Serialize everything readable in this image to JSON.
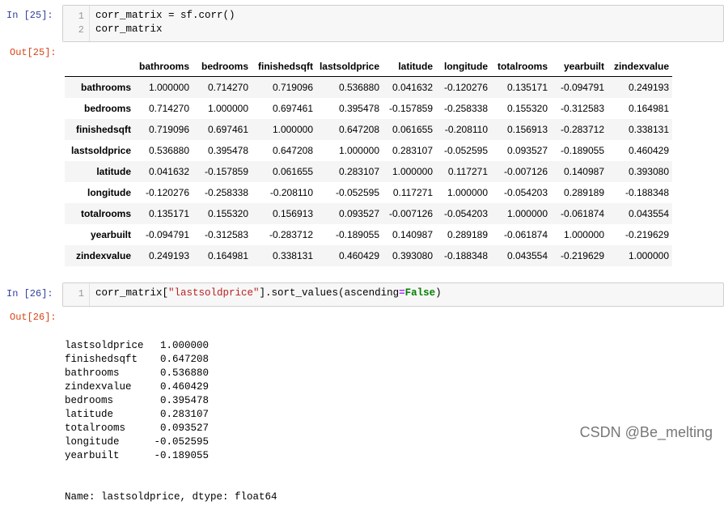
{
  "cell1": {
    "in_prompt": "In  [25]:",
    "line_numbers": [
      "1",
      "2"
    ],
    "code_line1": "corr_matrix = sf.corr()",
    "code_line2": "corr_matrix",
    "out_prompt": "Out[25]:"
  },
  "table": {
    "columns": [
      "bathrooms",
      "bedrooms",
      "finishedsqft",
      "lastsoldprice",
      "latitude",
      "longitude",
      "totalrooms",
      "yearbuilt",
      "zindexvalue"
    ],
    "rows": [
      {
        "label": "bathrooms",
        "values": [
          "1.000000",
          "0.714270",
          "0.719096",
          "0.536880",
          "0.041632",
          "-0.120276",
          "0.135171",
          "-0.094791",
          "0.249193"
        ]
      },
      {
        "label": "bedrooms",
        "values": [
          "0.714270",
          "1.000000",
          "0.697461",
          "0.395478",
          "-0.157859",
          "-0.258338",
          "0.155320",
          "-0.312583",
          "0.164981"
        ]
      },
      {
        "label": "finishedsqft",
        "values": [
          "0.719096",
          "0.697461",
          "1.000000",
          "0.647208",
          "0.061655",
          "-0.208110",
          "0.156913",
          "-0.283712",
          "0.338131"
        ]
      },
      {
        "label": "lastsoldprice",
        "values": [
          "0.536880",
          "0.395478",
          "0.647208",
          "1.000000",
          "0.283107",
          "-0.052595",
          "0.093527",
          "-0.189055",
          "0.460429"
        ]
      },
      {
        "label": "latitude",
        "values": [
          "0.041632",
          "-0.157859",
          "0.061655",
          "0.283107",
          "1.000000",
          "0.117271",
          "-0.007126",
          "0.140987",
          "0.393080"
        ]
      },
      {
        "label": "longitude",
        "values": [
          "-0.120276",
          "-0.258338",
          "-0.208110",
          "-0.052595",
          "0.117271",
          "1.000000",
          "-0.054203",
          "0.289189",
          "-0.188348"
        ]
      },
      {
        "label": "totalrooms",
        "values": [
          "0.135171",
          "0.155320",
          "0.156913",
          "0.093527",
          "-0.007126",
          "-0.054203",
          "1.000000",
          "-0.061874",
          "0.043554"
        ]
      },
      {
        "label": "yearbuilt",
        "values": [
          "-0.094791",
          "-0.312583",
          "-0.283712",
          "-0.189055",
          "0.140987",
          "0.289189",
          "-0.061874",
          "1.000000",
          "-0.219629"
        ]
      },
      {
        "label": "zindexvalue",
        "values": [
          "0.249193",
          "0.164981",
          "0.338131",
          "0.460429",
          "0.393080",
          "-0.188348",
          "0.043554",
          "-0.219629",
          "1.000000"
        ]
      }
    ]
  },
  "cell2": {
    "in_prompt": "In  [26]:",
    "line_number": "1",
    "code_pre": "corr_matrix[",
    "code_str": "\"lastsoldprice\"",
    "code_mid": "].sort_values(ascending",
    "code_eq": "=",
    "code_kw": "False",
    "code_post": ")",
    "out_prompt": "Out[26]:"
  },
  "series": {
    "items": [
      {
        "name": "lastsoldprice",
        "value": "1.000000"
      },
      {
        "name": "finishedsqft",
        "value": "0.647208"
      },
      {
        "name": "bathrooms",
        "value": "0.536880"
      },
      {
        "name": "zindexvalue",
        "value": "0.460429"
      },
      {
        "name": "bedrooms",
        "value": "0.395478"
      },
      {
        "name": "latitude",
        "value": "0.283107"
      },
      {
        "name": "totalrooms",
        "value": "0.093527"
      },
      {
        "name": "longitude",
        "value": "-0.052595"
      },
      {
        "name": "yearbuilt",
        "value": "-0.189055"
      }
    ],
    "footer": "Name: lastsoldprice, dtype: float64"
  },
  "watermark": "CSDN @Be_melting"
}
